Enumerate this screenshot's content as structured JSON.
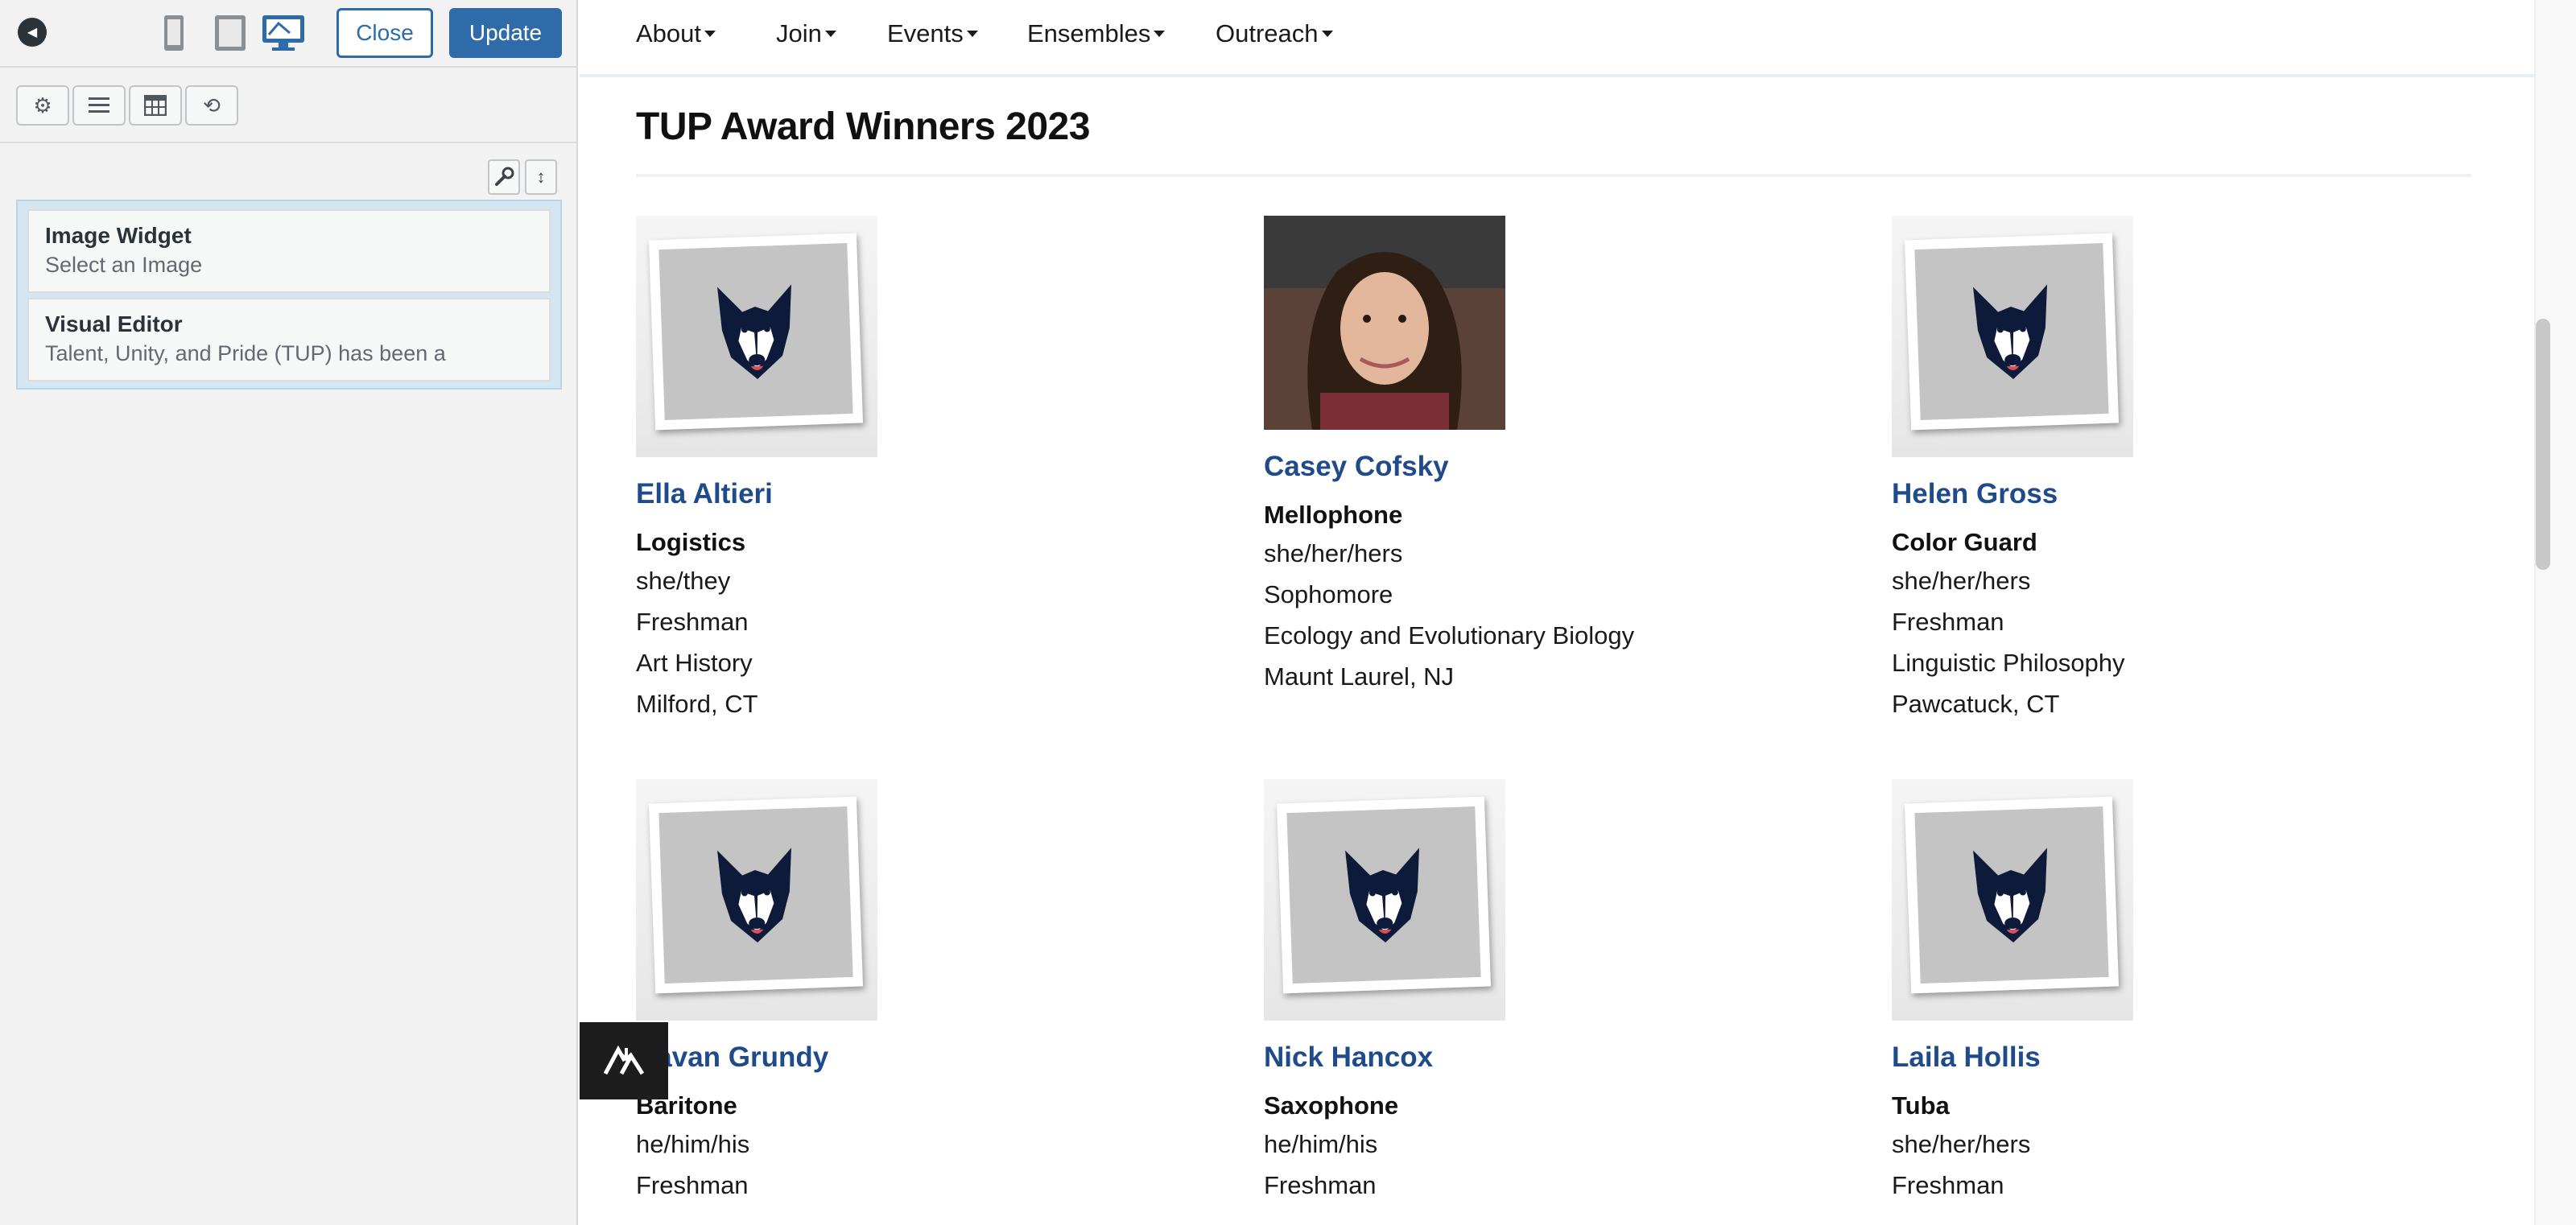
{
  "customizer": {
    "close_label": "Close",
    "update_label": "Update",
    "devices": [
      "mobile-icon",
      "tablet-icon",
      "desktop-icon"
    ],
    "tools": [
      "gear-icon",
      "list-icon",
      "layout-icon",
      "history-icon"
    ],
    "widgets": [
      {
        "title": "Image Widget",
        "description": "Select an Image"
      },
      {
        "title": "Visual Editor",
        "description": "Talent, Unity, and Pride (TUP) has been a"
      }
    ]
  },
  "nav": {
    "items": [
      "About",
      "Join",
      "Events",
      "Ensembles",
      "Outreach"
    ]
  },
  "page": {
    "title": "TUP Award Winners 2023"
  },
  "winners": [
    {
      "name": "Ella Altieri",
      "role": "Logistics",
      "details": [
        "she/they",
        "Freshman",
        "Art History",
        "Milford, CT"
      ],
      "photo": "husky-logo"
    },
    {
      "name": "Casey Cofsky",
      "role": "Mellophone",
      "details": [
        "she/her/hers",
        "Sophomore",
        "Ecology and Evolutionary Biology",
        "Maunt Laurel, NJ"
      ],
      "photo": "portrait"
    },
    {
      "name": "Helen Gross",
      "role": "Color Guard",
      "details": [
        "she/her/hers",
        "Freshman",
        "Linguistic Philosophy",
        "Pawcatuck, CT"
      ],
      "photo": "husky-logo"
    },
    {
      "name": "Cavan Grundy",
      "role": "Baritone",
      "details": [
        "he/him/his",
        "Freshman"
      ],
      "photo": "husky-logo"
    },
    {
      "name": "Nick Hancox",
      "role": "Saxophone",
      "details": [
        "he/him/his",
        "Freshman"
      ],
      "photo": "husky-logo"
    },
    {
      "name": "Laila Hollis",
      "role": "Tuba",
      "details": [
        "she/her/hers",
        "Freshman"
      ],
      "photo": "husky-logo"
    }
  ],
  "colors": {
    "accent": "#2e6ba8",
    "name_link": "#1f4b8a",
    "widget_area": "#d4e6f1"
  }
}
